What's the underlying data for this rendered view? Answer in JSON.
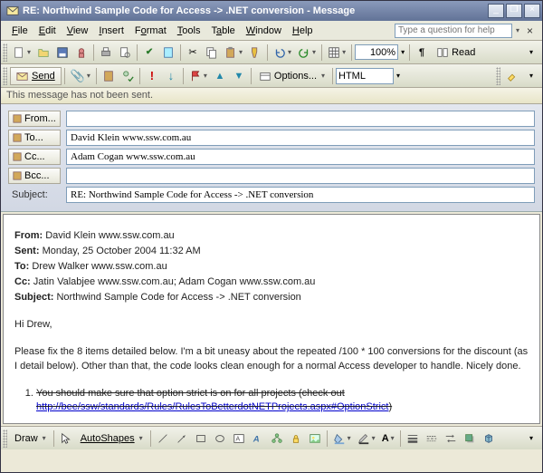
{
  "window": {
    "title": "RE: Northwind Sample Code for Access -> .NET conversion  - Message",
    "min": "_",
    "max": "□",
    "restore": "❐",
    "close": "×"
  },
  "menu": {
    "file": "File",
    "edit": "Edit",
    "view": "View",
    "insert": "Insert",
    "format": "Format",
    "tools": "Tools",
    "table": "Table",
    "window": "Window",
    "help": "Help",
    "help_placeholder": "Type a question for help"
  },
  "toolbar1": {
    "zoom": "100%",
    "read_label": "Read"
  },
  "toolbar2": {
    "send_label": "Send",
    "options_label": "Options...",
    "format_value": "HTML"
  },
  "infobar": {
    "text": "This message has not been sent."
  },
  "fields": {
    "from_label": "From...",
    "from_value": "",
    "to_label": "To...",
    "to_value": "David Klein www.ssw.com.au",
    "cc_label": "Cc...",
    "cc_value": "Adam Cogan www.ssw.com.au",
    "bcc_label": "Bcc...",
    "bcc_value": "",
    "subject_label": "Subject:",
    "subject_value": "RE: Northwind Sample Code for Access -> .NET conversion"
  },
  "body": {
    "from_l": "From:",
    "from_v": "David Klein www.ssw.com.au",
    "sent_l": "Sent:",
    "sent_v": "Monday, 25 October 2004 11:32 AM",
    "to_l": "To:",
    "to_v": "Drew Walker www.ssw.com.au",
    "cc_l": "Cc:",
    "cc_v": "Jatin Valabjee www.ssw.com.au; Adam Cogan www.ssw.com.au",
    "subj_l": "Subject:",
    "subj_v": "Northwind Sample Code for Access -> .NET conversion",
    "greeting": "Hi Drew,",
    "para1": "Please fix the 8 items detailed below. I'm a bit uneasy about the repeated /100 * 100 conversions for the discount (as I detail below). Other than that, the code looks clean enough for a normal Access developer to handle. Nicely done.",
    "li1_text": "You should make sure that option strict is on for all projects (check out ",
    "li1_link": "http://bee/ssw/standards/Rules/RulesToBetterdotNETProjects.aspx#OptionStrict",
    "li1_tail": ")"
  },
  "draw": {
    "label": "Draw",
    "autoshapes": "AutoShapes"
  }
}
